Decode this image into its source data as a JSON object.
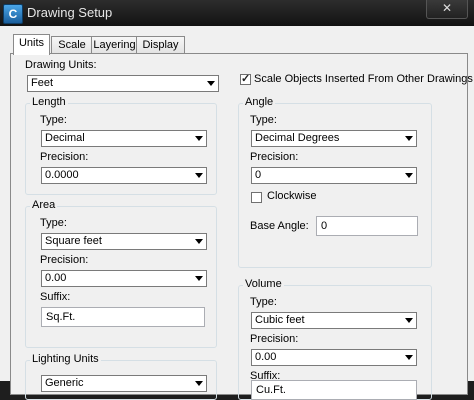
{
  "window": {
    "title": "Drawing Setup",
    "close_glyph": "✕",
    "icon_letter": "C"
  },
  "tabs": [
    {
      "label": "Units",
      "active": true
    },
    {
      "label": "Scale",
      "active": false
    },
    {
      "label": "Layering",
      "active": false
    },
    {
      "label": "Display",
      "active": false
    }
  ],
  "drawing_units": {
    "label": "Drawing Units:",
    "value": "Feet"
  },
  "scale_objects": {
    "label": "Scale Objects Inserted From Other Drawings",
    "checked": true
  },
  "length": {
    "title": "Length",
    "type_label": "Type:",
    "type_value": "Decimal",
    "precision_label": "Precision:",
    "precision_value": "0.0000"
  },
  "angle": {
    "title": "Angle",
    "type_label": "Type:",
    "type_value": "Decimal Degrees",
    "precision_label": "Precision:",
    "precision_value": "0",
    "clockwise_label": "Clockwise",
    "clockwise_checked": false,
    "base_angle_label": "Base Angle:",
    "base_angle_value": "0"
  },
  "area": {
    "title": "Area",
    "type_label": "Type:",
    "type_value": "Square feet",
    "precision_label": "Precision:",
    "precision_value": "0.00",
    "suffix_label": "Suffix:",
    "suffix_value": "Sq.Ft."
  },
  "volume": {
    "title": "Volume",
    "type_label": "Type:",
    "type_value": "Cubic feet",
    "precision_label": "Precision:",
    "precision_value": "0.00",
    "suffix_label": "Suffix:",
    "suffix_value": "Cu.Ft."
  },
  "lighting": {
    "title": "Lighting Units",
    "value": "Generic"
  }
}
